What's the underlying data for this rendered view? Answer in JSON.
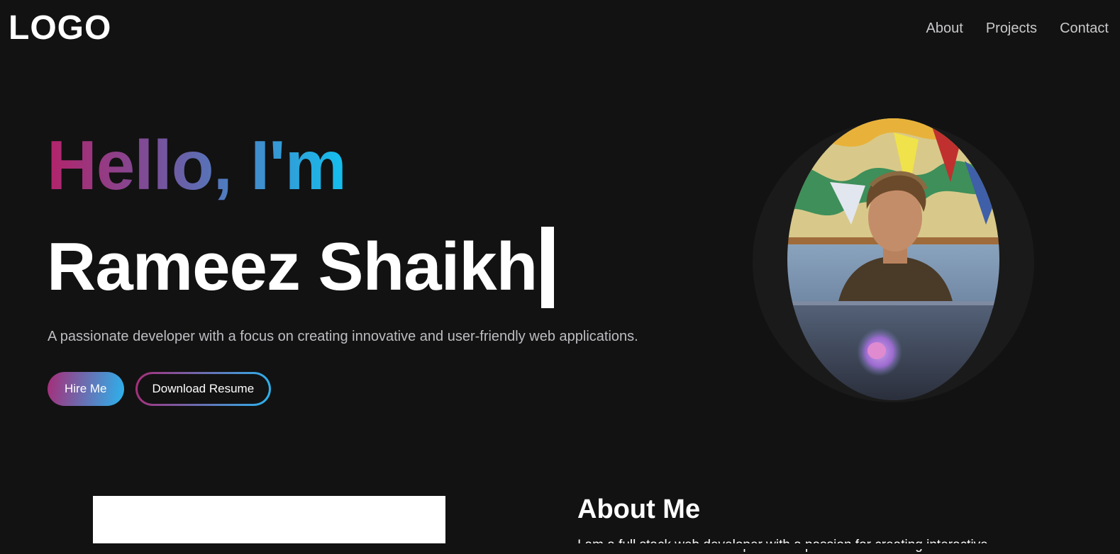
{
  "header": {
    "logo": "LOGO",
    "nav": [
      {
        "label": "About"
      },
      {
        "label": "Projects"
      },
      {
        "label": "Contact"
      }
    ]
  },
  "hero": {
    "greeting": "Hello, I'm",
    "name": "Rameez Shaikh",
    "tagline": "A passionate developer with a focus on creating innovative and user-friendly web applications.",
    "hire_button": "Hire Me",
    "resume_button": "Download Resume",
    "gradient_colors": [
      "#b3236a",
      "#13c0ef"
    ]
  },
  "about": {
    "title": "About Me",
    "text": "I am a full stack web developer with a passion for creating interactive"
  },
  "colors": {
    "background": "#121212",
    "text": "#ffffff",
    "muted": "#bdbdc2"
  }
}
